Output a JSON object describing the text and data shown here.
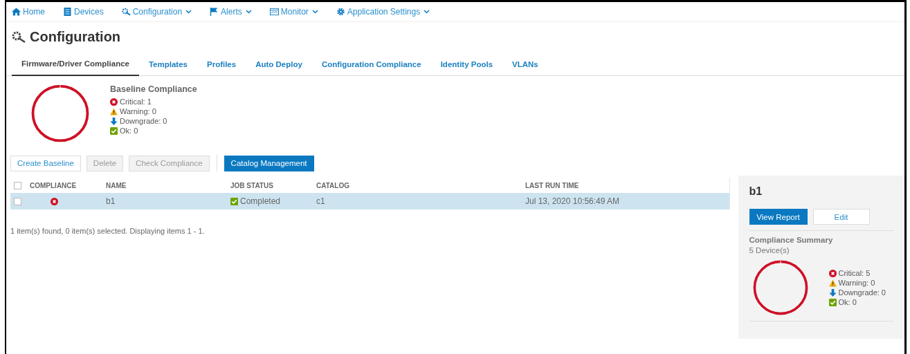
{
  "nav": [
    {
      "label": "Home",
      "kind": "home",
      "dropdown": false
    },
    {
      "label": "Devices",
      "kind": "devices",
      "dropdown": false
    },
    {
      "label": "Configuration",
      "kind": "config",
      "dropdown": true
    },
    {
      "label": "Alerts",
      "kind": "flag",
      "dropdown": true
    },
    {
      "label": "Monitor",
      "kind": "monitor",
      "dropdown": true
    },
    {
      "label": "Application Settings",
      "kind": "gear",
      "dropdown": true
    }
  ],
  "page_title": "Configuration",
  "tabs": [
    {
      "label": "Firmware/Driver Compliance",
      "selected": true
    },
    {
      "label": "Templates",
      "selected": false
    },
    {
      "label": "Profiles",
      "selected": false
    },
    {
      "label": "Auto Deploy",
      "selected": false
    },
    {
      "label": "Configuration Compliance",
      "selected": false
    },
    {
      "label": "Identity Pools",
      "selected": false
    },
    {
      "label": "VLANs",
      "selected": false
    }
  ],
  "baseline_summary": {
    "title": "Baseline Compliance",
    "legend": [
      {
        "kind": "critical",
        "label": "Critical: 1"
      },
      {
        "kind": "warning",
        "label": "Warning: 0"
      },
      {
        "kind": "downgrade",
        "label": "Downgrade: 0"
      },
      {
        "kind": "ok",
        "label": "Ok: 0"
      }
    ]
  },
  "toolbar": [
    {
      "label": "Create Baseline",
      "kind": "outline",
      "disabled": false
    },
    {
      "label": "Delete",
      "kind": "outline",
      "disabled": true
    },
    {
      "label": "Check Compliance",
      "kind": "outline",
      "disabled": true
    },
    {
      "label": "Catalog Management",
      "kind": "primary",
      "disabled": false
    }
  ],
  "table": {
    "header_checked": false,
    "columns": [
      "COMPLIANCE",
      "NAME",
      "JOB STATUS",
      "CATALOG",
      "LAST RUN TIME"
    ],
    "rows": [
      {
        "checked": false,
        "selected": true,
        "kind": "critical",
        "name": "b1",
        "job_status": "Completed",
        "catalog": "c1",
        "last_run_time": "Jul 13, 2020 10:56:49 AM"
      }
    ]
  },
  "footer": "1 item(s) found, 0 item(s) selected. Displaying items 1 - 1.",
  "detail": {
    "title": "b1",
    "buttons": [
      {
        "label": "View Report",
        "kind": "primary"
      },
      {
        "label": "Edit",
        "kind": "outline"
      }
    ],
    "summary_title": "Compliance Summary",
    "device_count": "5 Device(s)",
    "legend": [
      {
        "kind": "critical",
        "label": "Critical: 5"
      },
      {
        "kind": "warning",
        "label": "Warning: 0"
      },
      {
        "kind": "downgrade",
        "label": "Downgrade: 0"
      },
      {
        "kind": "ok",
        "label": "Ok: 0"
      }
    ]
  }
}
